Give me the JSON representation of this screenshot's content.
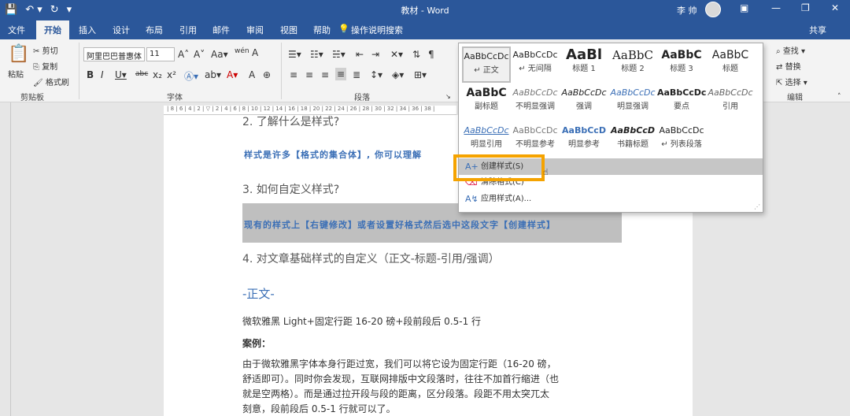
{
  "window": {
    "title": "教材 - Word",
    "user": "李 帅"
  },
  "tabs": [
    "文件",
    "开始",
    "插入",
    "设计",
    "布局",
    "引用",
    "邮件",
    "审阅",
    "视图",
    "帮助"
  ],
  "tell_me": "操作说明搜索",
  "share": "共享",
  "clipboard": {
    "paste": "粘贴",
    "cut": "剪切",
    "copy": "复制",
    "format_painter": "格式刷",
    "group": "剪贴板"
  },
  "font": {
    "name": "阿里巴巴普惠体",
    "size": "11",
    "group": "字体"
  },
  "paragraph": {
    "group": "段落"
  },
  "editing": {
    "find": "查找",
    "replace": "替换",
    "select": "选择",
    "group": "编辑"
  },
  "styles_gallery": {
    "row1": [
      {
        "sample": "AaBbCcDc",
        "name": "↵ 正文"
      },
      {
        "sample": "AaBbCcDc",
        "name": "↵ 无间隔"
      },
      {
        "sample": "AaBl",
        "name": "标题 1"
      },
      {
        "sample": "AaBbC",
        "name": "标题 2"
      },
      {
        "sample": "AaBbC",
        "name": "标题 3"
      },
      {
        "sample": "AaBbC",
        "name": "标题"
      }
    ],
    "row2": [
      {
        "sample": "AaBbC",
        "name": "副标题"
      },
      {
        "sample": "AaBbCcDc",
        "name": "不明显强调"
      },
      {
        "sample": "AaBbCcDc",
        "name": "强调"
      },
      {
        "sample": "AaBbCcDc",
        "name": "明显强调"
      },
      {
        "sample": "AaBbCcDc",
        "name": "要点"
      },
      {
        "sample": "AaBbCcDc",
        "name": "引用"
      }
    ],
    "row3": [
      {
        "sample": "AaBbCcDc",
        "name": "明显引用"
      },
      {
        "sample": "AaBbCcDc",
        "name": "不明显参考"
      },
      {
        "sample": "AaBbCcD",
        "name": "明显参考"
      },
      {
        "sample": "AaBbCcD",
        "name": "书籍标题"
      },
      {
        "sample": "AaBbCcDc",
        "name": "↵ 列表段落"
      }
    ],
    "menu": [
      "创建样式(S)",
      "清除格式(C)",
      "应用样式(A)..."
    ]
  },
  "document": {
    "h2_partial": "2. 了解什么是样式?",
    "blue_line": "样式是许多【格式的集合体】, 你可以理解",
    "h3": "3. 如何自定义样式?",
    "highlight_line": "现有的样式上【右键修改】或者设置好格式然后选中这段文字【创建样式】",
    "h4": "4. 对文章基础样式的自定义（正文-标题-引用/强调）",
    "section_title": "-正文-",
    "spec": "微软雅黑 Light+固定行距 16-20 磅+段前段后 0.5-1 行",
    "example_label": "案例：",
    "para_lines": [
      "由于微软雅黑字体本身行距过宽，我们可以将它设为固定行距（16-20 磅，",
      "舒适即可）。同时你会发现，互联网排版中文段落时，往往不加首行缩进（也",
      "就是空两格）。而是通过拉开段与段的距离，区分段落。段距不用太突兀太",
      "刻意，段前段后 0.5-1 行就可以了。"
    ]
  },
  "colors": {
    "brand": "#2b579a",
    "highlight_box": "#f5a300",
    "doc_blue": "#3b6fb6"
  }
}
